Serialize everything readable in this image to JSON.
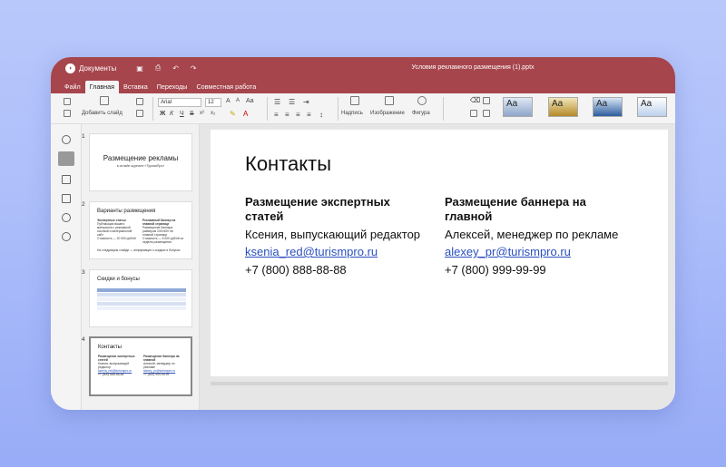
{
  "app": {
    "name": "Документы",
    "doc_title": "Условия рекламного размещения (1).pptx"
  },
  "tabs": [
    {
      "label": "Файл"
    },
    {
      "label": "Главная",
      "active": true
    },
    {
      "label": "Вставка"
    },
    {
      "label": "Переходы"
    },
    {
      "label": "Совместная работа"
    }
  ],
  "toolbar": {
    "add_slide": "Добавить слайд",
    "font": "Arial",
    "size": "12",
    "textbox": "Надпись",
    "image": "Изображение",
    "shape": "Фигура",
    "theme_label": "Aa"
  },
  "slides": [
    {
      "num": "1",
      "title": "Размещение рекламы",
      "subtitle": "в онлайн-журнале «ТуризмПро»"
    },
    {
      "num": "2",
      "title": "Варианты размещения",
      "col1_head": "Экспертные статьи",
      "col1_text": "Публикация вашего материала с рекламной ссылкой и материальной сайт",
      "col1_price": "Стоимость — 20 000 руб/ей",
      "col2_head": "Рекламный баннер на главной странице",
      "col2_text": "Размещение баннера размером 240×400 на главной странице",
      "col2_price": "Стоимость — 5 000 руб/ей за неделю размещения",
      "footer": "На следующем слайде — информация о скидках и бонусах"
    },
    {
      "num": "3",
      "title": "Скидки и бонусы"
    },
    {
      "num": "4",
      "title": "Контакты",
      "col1_head": "Размещение экспертных статей",
      "col1_name": "Ксения, выпускающий редактор",
      "col1_mail": "ksenia_red@turismpro.ru",
      "col1_phone": "+7 (800) 888-88-88",
      "col2_head": "Размещение баннера на главной",
      "col2_name": "Алексей, менеджер по рекламе",
      "col2_mail": "alexey_pr@turismpro.ru",
      "col2_phone": "+7 (800) 999-99-99"
    }
  ],
  "main_slide": {
    "title": "Контакты",
    "col1": {
      "heading": "Размещение экспертных статей",
      "name": "Ксения, выпускающий редактор",
      "email": "ksenia_red@turismpro.ru",
      "phone": "+7 (800) 888-88-88"
    },
    "col2": {
      "heading": "Размещение баннера на главной",
      "name": "Алексей, менеджер по рекламе",
      "email": "alexey_pr@turismpro.ru",
      "phone": "+7 (800) 999-99-99"
    }
  },
  "colors": {
    "titlebar": "#a6454c",
    "link": "#2a4fc0",
    "background": "#b9c8fb"
  }
}
